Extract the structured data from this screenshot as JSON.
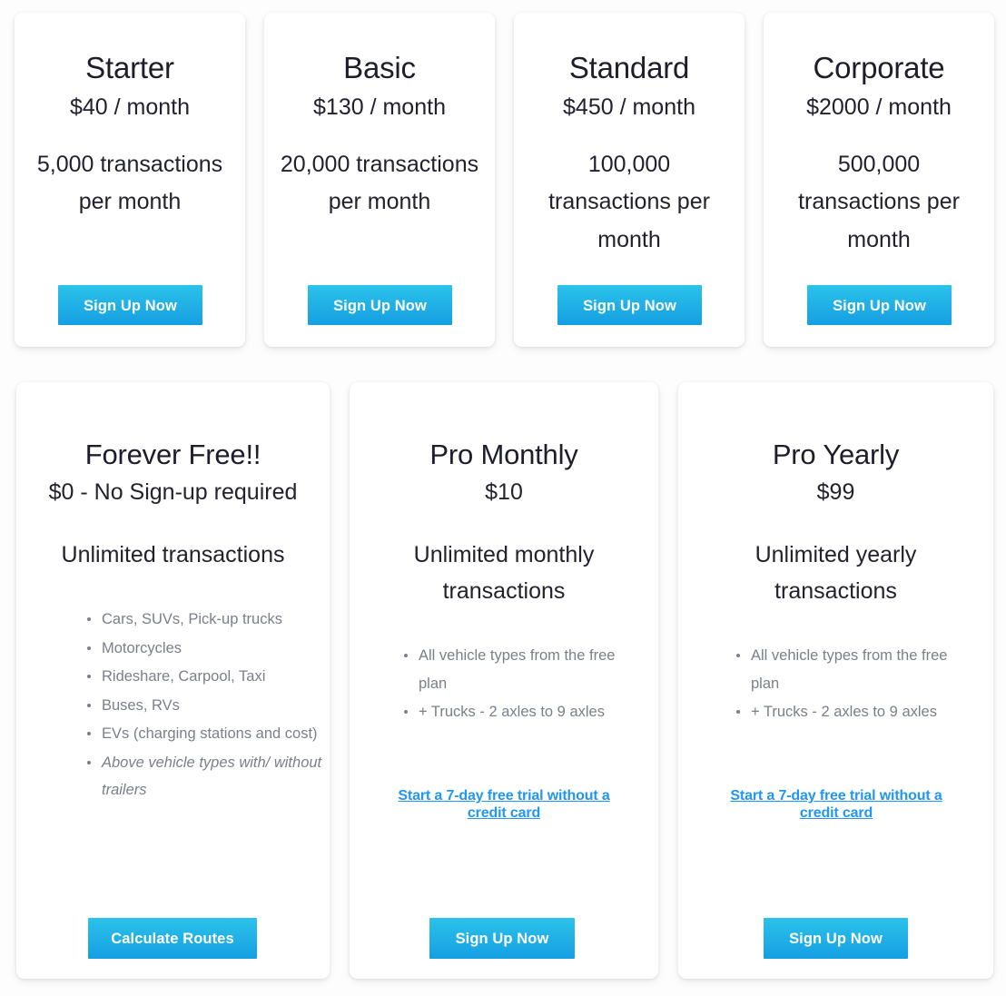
{
  "colors": {
    "accent": "#22b2e6",
    "accent_light": "#2bc3ea",
    "accent_dark": "#159fe3",
    "link": "#2196f3",
    "heading": "#1d1d2b",
    "muted": "#7b7f89",
    "card_bg": "#ffffff",
    "page_bg": "#fdfdfd"
  },
  "top_plans": [
    {
      "title": "Starter",
      "price": "$40 / month",
      "quota": "5,000 transactions per month",
      "cta": "Sign Up Now"
    },
    {
      "title": "Basic",
      "price": "$130 / month",
      "quota": "20,000 transactions per month",
      "cta": "Sign Up Now"
    },
    {
      "title": "Standard",
      "price": "$450 / month",
      "quota": "100,000 transactions per month",
      "cta": "Sign Up Now"
    },
    {
      "title": "Corporate",
      "price": "$2000 / month",
      "quota": "500,000 transactions per month",
      "cta": "Sign Up Now"
    }
  ],
  "bottom_plans": [
    {
      "title": "Forever Free!!",
      "price": "$0 - No Sign-up required",
      "quota": "Unlimited transactions",
      "features": [
        {
          "text": "Cars, SUVs, Pick-up trucks",
          "italic": false
        },
        {
          "text": "Motorcycles",
          "italic": false
        },
        {
          "text": "Rideshare, Carpool, Taxi",
          "italic": false
        },
        {
          "text": "Buses, RVs",
          "italic": false
        },
        {
          "text": "EVs (charging stations and cost)",
          "italic": false
        },
        {
          "text": "Above vehicle types with/ without trailers",
          "italic": true
        }
      ],
      "trial_link": "",
      "cta": "Calculate Routes"
    },
    {
      "title": "Pro Monthly",
      "price": "$10",
      "quota": "Unlimited monthly transactions",
      "features": [
        {
          "text": "All vehicle types from the free plan",
          "italic": false
        },
        {
          "text": "+ Trucks - 2 axles to 9 axles",
          "italic": false
        }
      ],
      "trial_link": "Start a 7-day free trial without a credit card",
      "cta": "Sign Up Now"
    },
    {
      "title": "Pro Yearly",
      "price": "$99",
      "quota": "Unlimited yearly transactions",
      "features": [
        {
          "text": "All vehicle types from the free plan",
          "italic": false
        },
        {
          "text": "+ Trucks - 2 axles to 9 axles",
          "italic": false
        }
      ],
      "trial_link": "Start a 7-day free trial without a credit card",
      "cta": "Sign Up Now"
    }
  ]
}
